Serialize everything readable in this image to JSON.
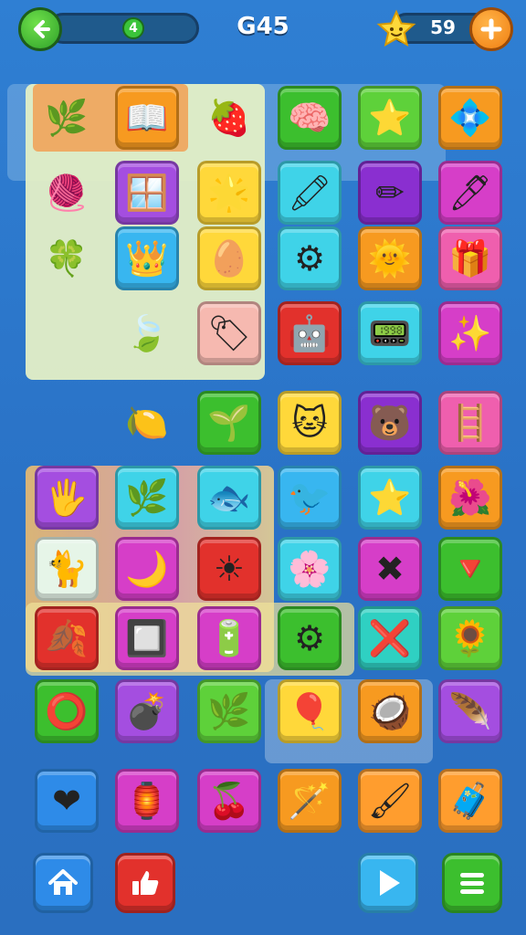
{
  "header": {
    "progress_value": "4",
    "level_label": "G45",
    "stars_count": "59",
    "back_icon": "arrow-left-icon",
    "add_icon": "plus-icon"
  },
  "colors": {
    "background": "#2f7fd3",
    "back_button": "#3bc43a",
    "add_button": "#f07f12",
    "star": "#ffd83a"
  },
  "tiles": [
    {
      "icon": "leaf-icon",
      "glyph": "🌿",
      "color": "orange-panel"
    },
    {
      "icon": "book-icon",
      "glyph": "📖",
      "color": "orange"
    },
    {
      "icon": "strawberry-icon",
      "glyph": "🍓",
      "color": "pale"
    },
    {
      "icon": "brain-icon",
      "glyph": "🧠",
      "color": "green"
    },
    {
      "icon": "star-face-icon",
      "glyph": "⭐",
      "color": "lime"
    },
    {
      "icon": "gem-icon",
      "glyph": "💠",
      "color": "orange"
    },
    {
      "icon": "yarn-ball-icon",
      "glyph": "🧶",
      "color": "pale"
    },
    {
      "icon": "window-icon",
      "glyph": "🪟",
      "color": "violet"
    },
    {
      "icon": "star-smile-icon",
      "glyph": "🌟",
      "color": "yellow"
    },
    {
      "icon": "crayon-icon",
      "glyph": "🖍",
      "color": "cyan"
    },
    {
      "icon": "pencil-icon",
      "glyph": "✏",
      "color": "purple"
    },
    {
      "icon": "marker-icon",
      "glyph": "🖊",
      "color": "magenta"
    },
    {
      "icon": "wreath-icon",
      "glyph": "🍀",
      "color": "pale"
    },
    {
      "icon": "crown-face-icon",
      "glyph": "👑",
      "color": "sky"
    },
    {
      "icon": "egg-icon",
      "glyph": "🥚",
      "color": "yellow"
    },
    {
      "icon": "gear-box-icon",
      "glyph": "⚙",
      "color": "cyan"
    },
    {
      "icon": "sun-face-icon",
      "glyph": "🌞",
      "color": "orange"
    },
    {
      "icon": "gift-box-icon",
      "glyph": "🎁",
      "color": "pink"
    },
    {
      "icon": "leaf-pair-icon",
      "glyph": "🍃",
      "color": "pale"
    },
    {
      "icon": "tag-icon",
      "glyph": "🏷",
      "color": "peach"
    },
    {
      "icon": "robot-icon",
      "glyph": "🤖",
      "color": "red"
    },
    {
      "icon": "remote-icon",
      "glyph": "📟",
      "color": "cyan"
    },
    {
      "icon": "sparkle-box-icon",
      "glyph": "✨",
      "color": "magenta"
    },
    {
      "icon": "lemon-icon",
      "glyph": "🍋",
      "color": "pale"
    },
    {
      "icon": "basil-icon",
      "glyph": "🌱",
      "color": "green"
    },
    {
      "icon": "cat-face-icon",
      "glyph": "🐱",
      "color": "yellow"
    },
    {
      "icon": "bear-face-icon",
      "glyph": "🐻",
      "color": "purple"
    },
    {
      "icon": "ladder-icon",
      "glyph": "🪜",
      "color": "pink"
    },
    {
      "icon": "hand-icon",
      "glyph": "🖐",
      "color": "violet"
    },
    {
      "icon": "fern-icon",
      "glyph": "🌿",
      "color": "cyan"
    },
    {
      "icon": "fish-icon",
      "glyph": "🐟",
      "color": "cyan"
    },
    {
      "icon": "bird-icon",
      "glyph": "🐦",
      "color": "sky"
    },
    {
      "icon": "star-icon",
      "glyph": "⭐",
      "color": "cyan"
    },
    {
      "icon": "flower-face-icon",
      "glyph": "🌺",
      "color": "orange"
    },
    {
      "icon": "cat-icon",
      "glyph": "🐈",
      "color": "cream"
    },
    {
      "icon": "moon-icon",
      "glyph": "🌙",
      "color": "magenta"
    },
    {
      "icon": "sun-icon",
      "glyph": "☀",
      "color": "red"
    },
    {
      "icon": "flower-icon",
      "glyph": "🌸",
      "color": "cyan"
    },
    {
      "icon": "crossbones-icon",
      "glyph": "✖",
      "color": "magenta"
    },
    {
      "icon": "arrowhead-icon",
      "glyph": "🔻",
      "color": "green"
    },
    {
      "icon": "leaf-arrow-icon",
      "glyph": "🍂",
      "color": "red"
    },
    {
      "icon": "frame-icon",
      "glyph": "🔲",
      "color": "magenta"
    },
    {
      "icon": "battery-icon",
      "glyph": "🔋",
      "color": "magenta"
    },
    {
      "icon": "cog-icon",
      "glyph": "⚙",
      "color": "green"
    },
    {
      "icon": "crossed-sticks-icon",
      "glyph": "❌",
      "color": "teal"
    },
    {
      "icon": "sunflower-icon",
      "glyph": "🌻",
      "color": "lime"
    },
    {
      "icon": "ring-icon",
      "glyph": "⭕",
      "color": "green"
    },
    {
      "icon": "bomb-icon",
      "glyph": "💣",
      "color": "violet"
    },
    {
      "icon": "leaves-icon",
      "glyph": "🌿",
      "color": "lime"
    },
    {
      "icon": "balloon-heart-icon",
      "glyph": "🎈",
      "color": "yellow"
    },
    {
      "icon": "lemon-slice-icon",
      "glyph": "🥥",
      "color": "orange"
    },
    {
      "icon": "feather-icon",
      "glyph": "🪶",
      "color": "violet"
    },
    {
      "icon": "heart-icon",
      "glyph": "❤",
      "color": "blue"
    },
    {
      "icon": "lantern-icon",
      "glyph": "🏮",
      "color": "magenta"
    },
    {
      "icon": "berry-icon",
      "glyph": "🍒",
      "color": "magenta"
    },
    {
      "icon": "wand-icon",
      "glyph": "🪄",
      "color": "orange"
    },
    {
      "icon": "brush-icon",
      "glyph": "🖌",
      "color": "orange2"
    },
    {
      "icon": "bag-icon",
      "glyph": "🧳",
      "color": "orange2"
    },
    {
      "icon": "fox-face-icon",
      "glyph": "🦊",
      "color": "magenta"
    },
    {
      "icon": "pizza-icon",
      "glyph": "🍕",
      "color": "pink"
    },
    {
      "icon": "puzzle-star-icon",
      "glyph": "🌟",
      "color": "sky"
    },
    {
      "icon": "frog-face-icon",
      "glyph": "🐸",
      "color": "cyan"
    },
    {
      "icon": "crab-icon",
      "glyph": "🦀",
      "color": "cyan"
    },
    {
      "icon": "shell-icon",
      "glyph": "🐚",
      "color": "green"
    }
  ],
  "nav": {
    "home_icon": "home-icon",
    "like_icon": "thumbs-up-icon",
    "play_icon": "play-icon",
    "menu_icon": "menu-icon"
  }
}
